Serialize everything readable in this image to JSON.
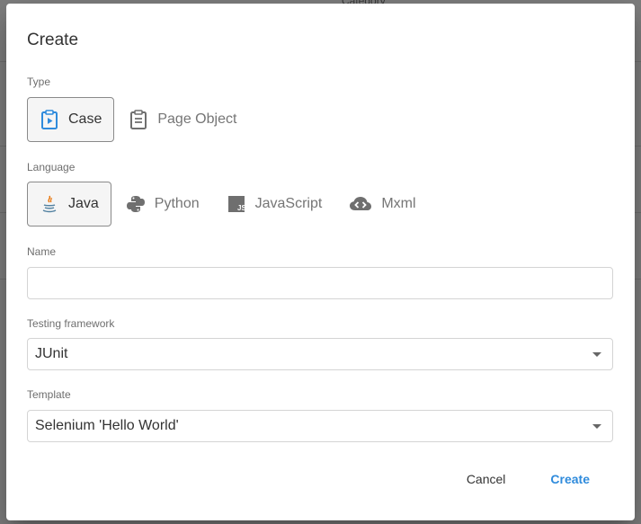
{
  "background": {
    "column_header": "Category"
  },
  "dialog": {
    "title": "Create",
    "type": {
      "label": "Type",
      "options": [
        {
          "label": "Case",
          "icon": "clipboard-play-icon",
          "selected": true
        },
        {
          "label": "Page Object",
          "icon": "clipboard-list-icon",
          "selected": false
        }
      ]
    },
    "language": {
      "label": "Language",
      "options": [
        {
          "label": "Java",
          "icon": "java-icon",
          "selected": true
        },
        {
          "label": "Python",
          "icon": "python-icon",
          "selected": false
        },
        {
          "label": "JavaScript",
          "icon": "javascript-icon",
          "selected": false
        },
        {
          "label": "Mxml",
          "icon": "cloud-code-icon",
          "selected": false
        }
      ]
    },
    "name": {
      "label": "Name",
      "value": "",
      "placeholder": ""
    },
    "framework": {
      "label": "Testing framework",
      "value": "JUnit"
    },
    "template": {
      "label": "Template",
      "value": "Selenium 'Hello World'"
    },
    "buttons": {
      "cancel": "Cancel",
      "create": "Create"
    }
  },
  "colors": {
    "accent": "#2f8bdc",
    "selected_border": "#8a8a8a"
  }
}
